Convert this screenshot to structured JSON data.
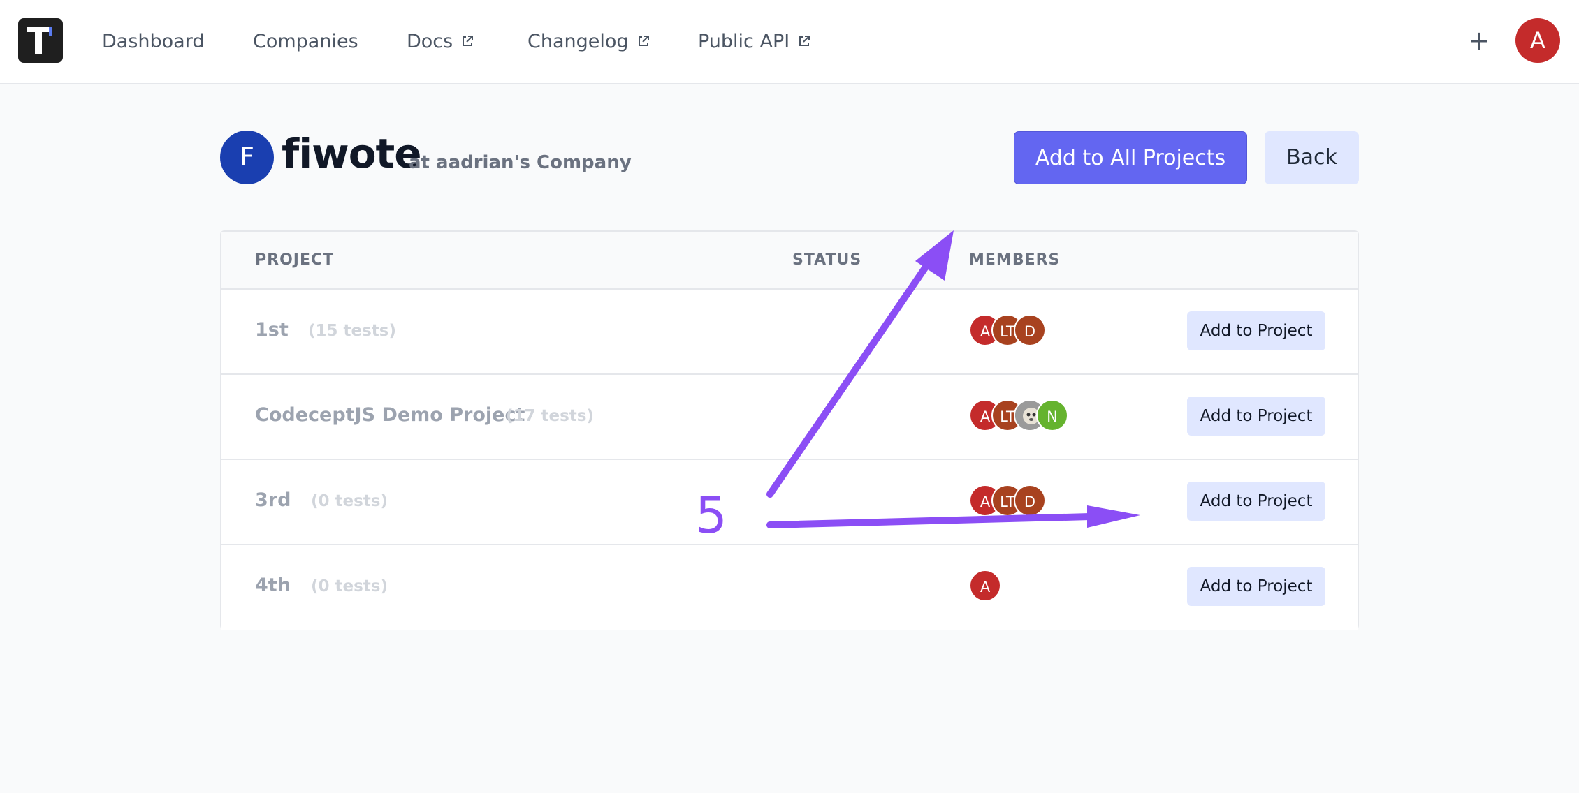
{
  "nav": {
    "dashboard": "Dashboard",
    "companies": "Companies",
    "docs": "Docs",
    "changelog": "Changelog",
    "public_api": "Public API",
    "plus": "+",
    "user_initial": "A"
  },
  "header": {
    "avatar_initial": "F",
    "name": "fiwote",
    "company": "at aadrian's Company",
    "add_all_label": "Add to All Projects",
    "back_label": "Back"
  },
  "table": {
    "columns": [
      "PROJECT",
      "STATUS",
      "MEMBERS"
    ],
    "rows": [
      {
        "name": "1st",
        "tests": "(15 tests)",
        "button": "Add to Project",
        "members": [
          {
            "label": "A",
            "color": "#c42b2b"
          },
          {
            "label": "LT",
            "color": "#a8421f"
          },
          {
            "label": "D",
            "color": "#a8421f"
          }
        ]
      },
      {
        "name": "CodeceptJS Demo Project",
        "tests": "(17 tests)",
        "button": "Add to Project",
        "members": [
          {
            "label": "A",
            "color": "#c42b2b"
          },
          {
            "label": "LT",
            "color": "#a8421f"
          },
          {
            "label": "",
            "color": "#8a8a8a"
          },
          {
            "label": "N",
            "color": "#65b32e"
          }
        ]
      },
      {
        "name": "3rd",
        "tests": "(0 tests)",
        "button": "Add to Project",
        "members": [
          {
            "label": "A",
            "color": "#c42b2b"
          },
          {
            "label": "LT",
            "color": "#a8421f"
          },
          {
            "label": "D",
            "color": "#a8421f"
          }
        ]
      },
      {
        "name": "4th",
        "tests": "(0 tests)",
        "button": "Add to Project",
        "members": [
          {
            "label": "A",
            "color": "#c42b2b"
          }
        ]
      }
    ]
  },
  "annotation": {
    "number": "5",
    "color": "#8b4ef5"
  }
}
